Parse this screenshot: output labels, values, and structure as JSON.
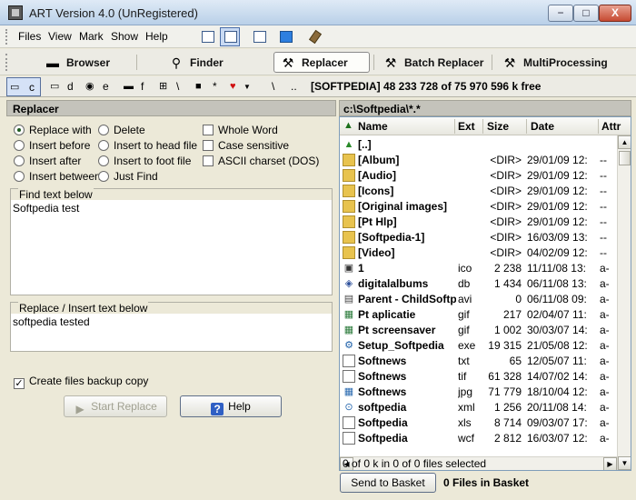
{
  "window": {
    "title": "ART Version 4.0 (UnRegistered)",
    "min_label": "−",
    "max_label": "□",
    "close_label": "X"
  },
  "menu": {
    "items": [
      "Files",
      "View",
      "Mark",
      "Show",
      "Help"
    ]
  },
  "tabs": [
    {
      "label": "Browser",
      "icon": "browser-icon",
      "active": false
    },
    {
      "label": "Finder",
      "icon": "magnifier-icon",
      "active": false
    },
    {
      "label": "Replacer",
      "icon": "wrench-icon",
      "active": true
    },
    {
      "label": "Batch Replacer",
      "icon": "wrench-icon",
      "active": false
    },
    {
      "label": "MultiProcessing",
      "icon": "wrench-icon",
      "active": false
    }
  ],
  "drives": [
    {
      "label": "c",
      "active": true
    },
    {
      "label": "d"
    },
    {
      "label": "e"
    },
    {
      "label": "f"
    },
    {
      "label": "\\"
    },
    {
      "label": "*"
    },
    {
      "label": ""
    },
    {
      "label": "\\"
    },
    {
      "label": ".."
    }
  ],
  "drive_info": "[SOFTPEDIA]  48 233 728 of 75 970 596 k free",
  "replacer": {
    "header": "Replacer",
    "options": {
      "replace_with": "Replace with",
      "insert_before": "Insert before",
      "insert_after": "Insert after",
      "insert_between": "Insert between",
      "delete": "Delete",
      "insert_head": "Insert to head file",
      "insert_foot": "Insert to foot file",
      "just_find": "Just Find"
    },
    "checks": {
      "whole_word": "Whole Word",
      "case_sensitive": "Case sensitive",
      "ascii": "ASCII charset (DOS)"
    },
    "find_title": "Find text below",
    "find_text": "Softpedia test",
    "replace_title": "Replace / Insert text below",
    "replace_text": "softpedia tested",
    "backup_label": "Create files backup copy",
    "start_label": "Start Replace",
    "help_label": "Help"
  },
  "browser": {
    "path": "c:\\Softpedia\\*.*",
    "columns": {
      "name": "Name",
      "ext": "Ext",
      "size": "Size",
      "date": "Date",
      "attr": "Attr"
    },
    "rows": [
      {
        "name": "[..]",
        "ext": "",
        "size": "",
        "date": "",
        "attr": "",
        "type": "up"
      },
      {
        "name": "[Album]",
        "ext": "",
        "size": "<DIR>",
        "date": "29/01/09 12:",
        "attr": "--",
        "type": "folder"
      },
      {
        "name": "[Audio]",
        "ext": "",
        "size": "<DIR>",
        "date": "29/01/09 12:",
        "attr": "--",
        "type": "folder"
      },
      {
        "name": "[Icons]",
        "ext": "",
        "size": "<DIR>",
        "date": "29/01/09 12:",
        "attr": "--",
        "type": "folder"
      },
      {
        "name": "[Original images]",
        "ext": "",
        "size": "<DIR>",
        "date": "29/01/09 12:",
        "attr": "--",
        "type": "folder"
      },
      {
        "name": "[Pt Hlp]",
        "ext": "",
        "size": "<DIR>",
        "date": "29/01/09 12:",
        "attr": "--",
        "type": "folder"
      },
      {
        "name": "[Softpedia-1]",
        "ext": "",
        "size": "<DIR>",
        "date": "16/03/09 13:",
        "attr": "--",
        "type": "folder"
      },
      {
        "name": "[Video]",
        "ext": "",
        "size": "<DIR>",
        "date": "04/02/09 12:",
        "attr": "--",
        "type": "folder"
      },
      {
        "name": "1",
        "ext": "ico",
        "size": "2 238",
        "date": "11/11/08 13:",
        "attr": "a-",
        "type": "ico"
      },
      {
        "name": "digitalalbums",
        "ext": "db",
        "size": "1 434",
        "date": "06/11/08 13:",
        "attr": "a-",
        "type": "db"
      },
      {
        "name": "Parent - ChildSoftp",
        "ext": "avi",
        "size": "0",
        "date": "06/11/08 09:",
        "attr": "a-",
        "type": "avi"
      },
      {
        "name": "Pt aplicatie",
        "ext": "gif",
        "size": "217",
        "date": "02/04/07 11:",
        "attr": "a-",
        "type": "gif"
      },
      {
        "name": "Pt screensaver",
        "ext": "gif",
        "size": "1 002",
        "date": "30/03/07 14:",
        "attr": "a-",
        "type": "gif"
      },
      {
        "name": "Setup_Softpedia",
        "ext": "exe",
        "size": "19 315",
        "date": "21/05/08 12:",
        "attr": "a-",
        "type": "exe"
      },
      {
        "name": "Softnews",
        "ext": "txt",
        "size": "65",
        "date": "12/05/07 11:",
        "attr": "a-",
        "type": "doc"
      },
      {
        "name": "Softnews",
        "ext": "tif",
        "size": "61 328",
        "date": "14/07/02 14:",
        "attr": "a-",
        "type": "doc"
      },
      {
        "name": "Softnews",
        "ext": "jpg",
        "size": "71 779",
        "date": "18/10/04 12:",
        "attr": "a-",
        "type": "jpg"
      },
      {
        "name": "softpedia",
        "ext": "xml",
        "size": "1 256",
        "date": "20/11/08 14:",
        "attr": "a-",
        "type": "xml"
      },
      {
        "name": "Softpedia",
        "ext": "xls",
        "size": "8 714",
        "date": "09/03/07 17:",
        "attr": "a-",
        "type": "doc"
      },
      {
        "name": "Softpedia",
        "ext": "wcf",
        "size": "2 812",
        "date": "16/03/07 12:",
        "attr": "a-",
        "type": "doc"
      }
    ],
    "status": "0 of 0 k in 0 of 0 files selected",
    "send_label": "Send to Basket",
    "basket_status": "0 Files in Basket"
  }
}
